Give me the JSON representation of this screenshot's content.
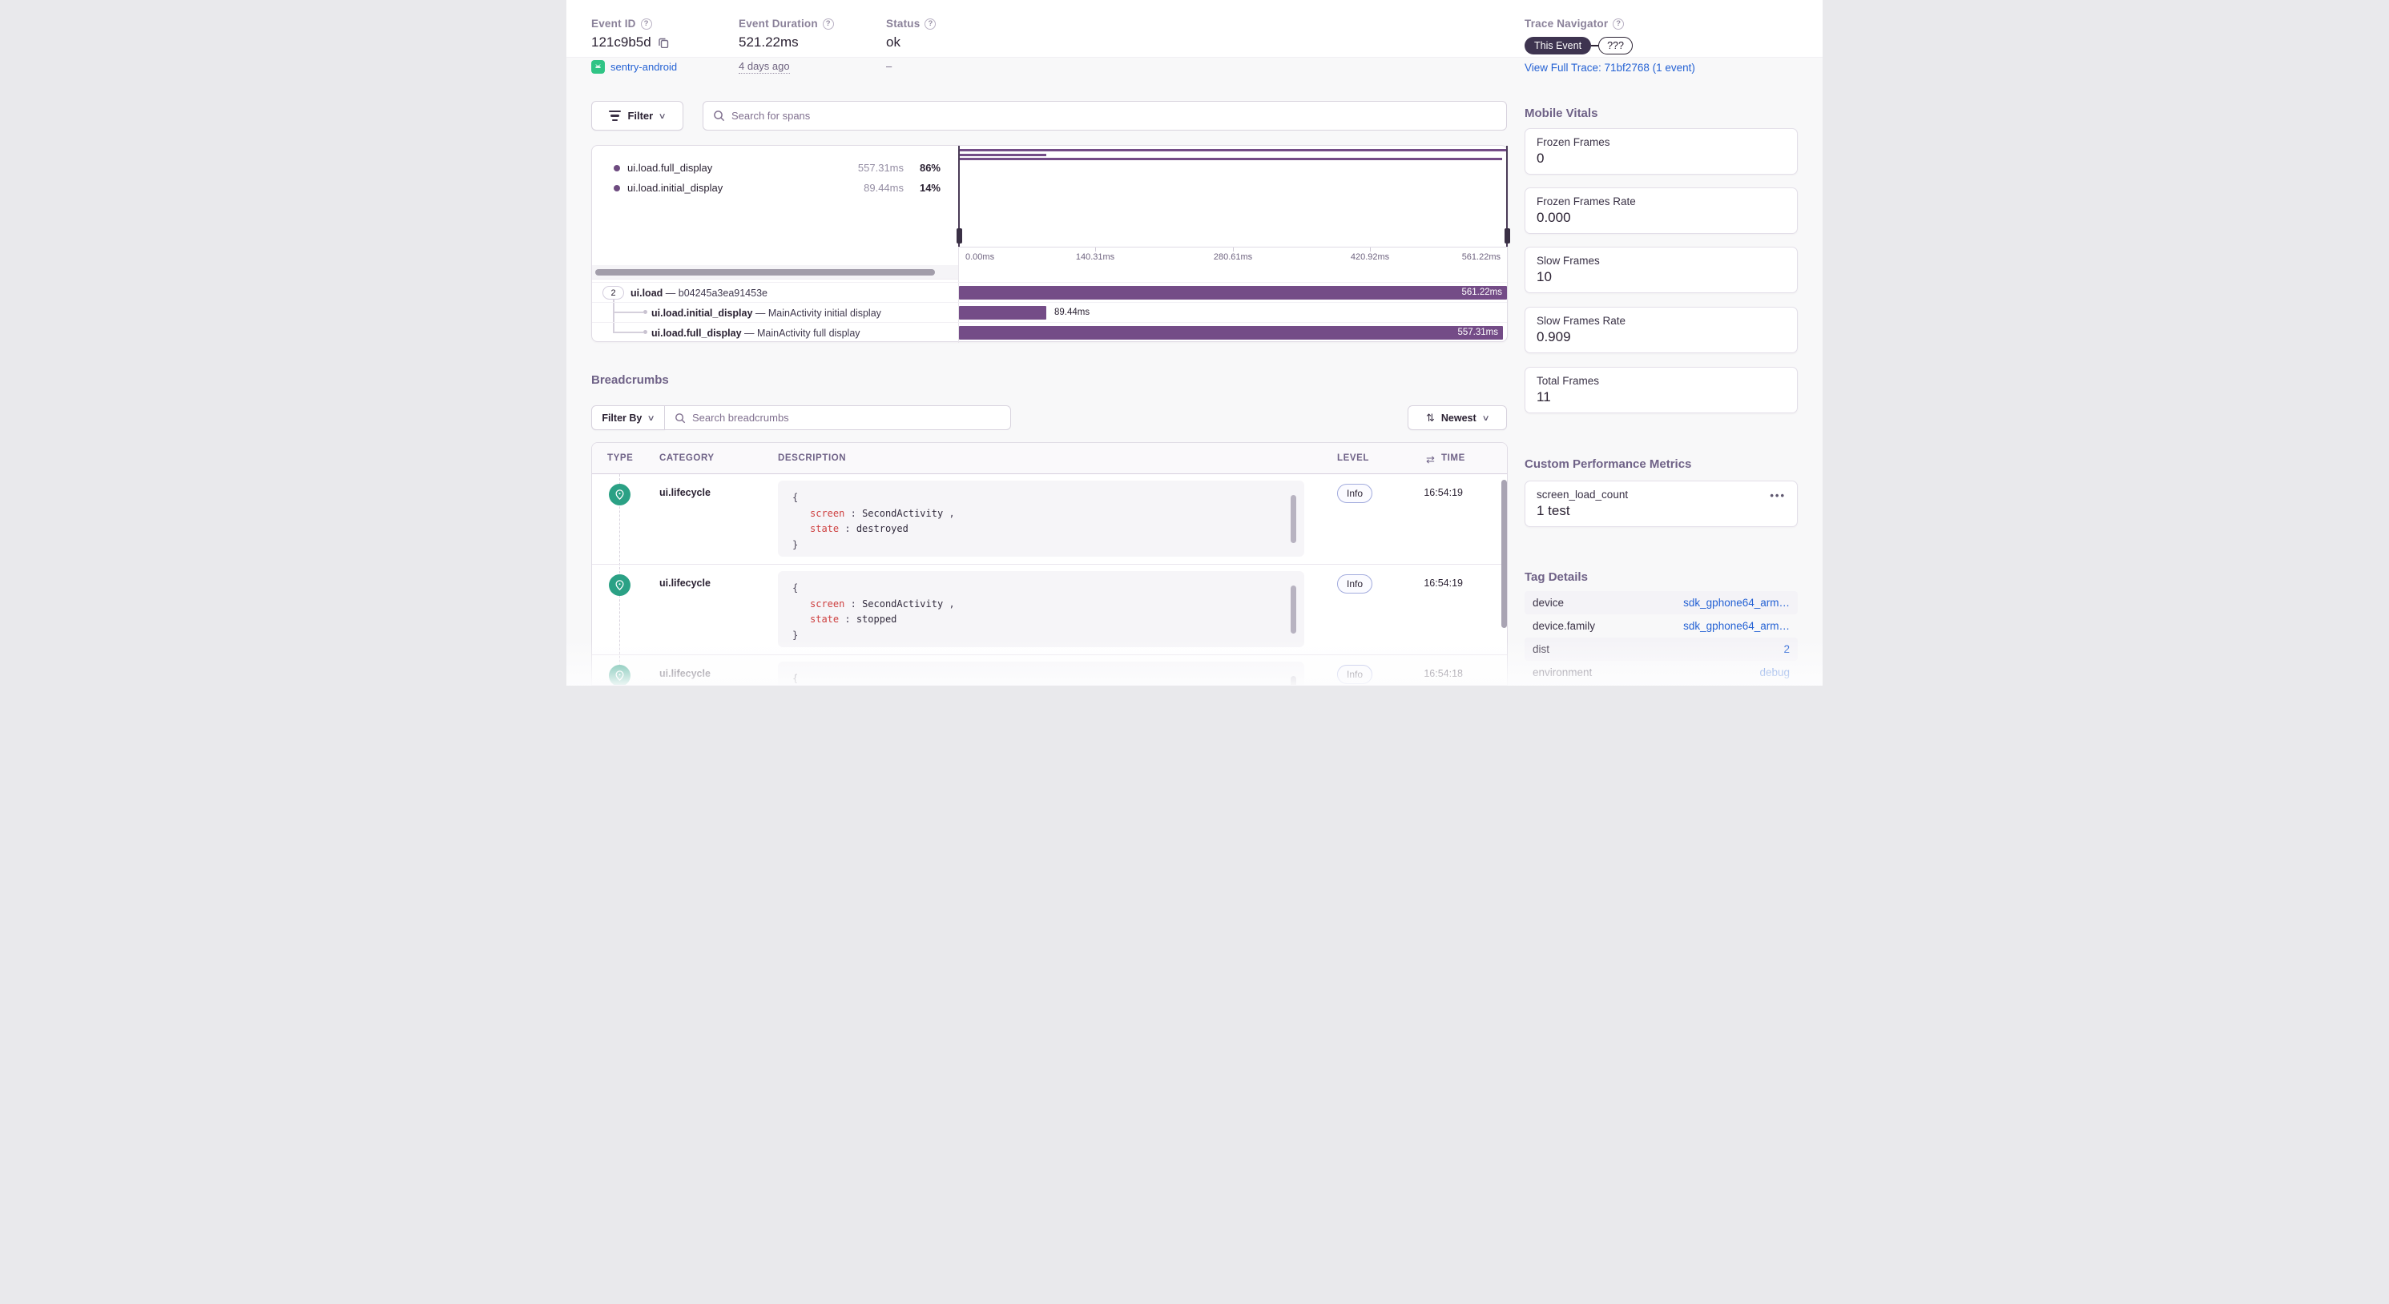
{
  "icons": {
    "help": "?",
    "chevron_down": "∨",
    "sort_updown": "⇅",
    "sort_leftright": "⇄",
    "ellipsis": "•••"
  },
  "header": {
    "event_id": {
      "label": "Event ID",
      "value": "121c9b5d",
      "project": "sentry-android"
    },
    "duration": {
      "label": "Event Duration",
      "value": "521.22ms",
      "age": "4 days ago"
    },
    "status": {
      "label": "Status",
      "value": "ok",
      "sub": "–"
    }
  },
  "trace_navigator": {
    "title": "Trace Navigator",
    "this_event": "This Event",
    "unknown": "???",
    "link": "View Full Trace: 71bf2768 (1 event)"
  },
  "spans": {
    "filter_label": "Filter",
    "search_placeholder": "Search for spans",
    "dash": "—",
    "legend": [
      {
        "name": "ui.load.full_display",
        "duration": "557.31ms",
        "percent": "86%"
      },
      {
        "name": "ui.load.initial_display",
        "duration": "89.44ms",
        "percent": "14%"
      }
    ],
    "minimap_bars": [
      {
        "width_pct": 100
      },
      {
        "width_pct": 15.9
      },
      {
        "width_pct": 99.3
      }
    ],
    "axis_ticks": [
      "0.00ms",
      "140.31ms",
      "280.61ms",
      "420.92ms",
      "561.22ms"
    ],
    "tree": [
      {
        "badge": "2",
        "op": "ui.load",
        "description": "b04245a3ea91453e",
        "duration": "561.22ms",
        "bar_width_pct": 100
      },
      {
        "op": "ui.load.initial_display",
        "description": "MainActivity initial display",
        "duration": "89.44ms",
        "bar_width_pct": 15.9
      },
      {
        "op": "ui.load.full_display",
        "description": "MainActivity full display",
        "duration": "557.31ms",
        "bar_width_pct": 99.3
      }
    ]
  },
  "breadcrumbs": {
    "title": "Breadcrumbs",
    "filter_label": "Filter By",
    "search_placeholder": "Search breadcrumbs",
    "sort_label": "Newest",
    "columns": [
      "TYPE",
      "CATEGORY",
      "DESCRIPTION",
      "LEVEL",
      "TIME"
    ],
    "punct": {
      "open": "{",
      "close": "}",
      "colon": ":",
      "comma": ","
    },
    "rows": [
      {
        "category": "ui.lifecycle",
        "level": "Info",
        "time": "16:54:19",
        "code": {
          "k1": "screen",
          "v1": "SecondActivity",
          "k2": "state",
          "v2": "destroyed"
        }
      },
      {
        "category": "ui.lifecycle",
        "level": "Info",
        "time": "16:54:19",
        "code": {
          "k1": "screen",
          "v1": "SecondActivity",
          "k2": "state",
          "v2": "stopped"
        }
      },
      {
        "category": "ui.lifecycle",
        "level": "Info",
        "time": "16:54:18",
        "code": {}
      }
    ]
  },
  "mobile_vitals": {
    "title": "Mobile Vitals",
    "cards": [
      {
        "label": "Frozen Frames",
        "value": "0"
      },
      {
        "label": "Frozen Frames Rate",
        "value": "0.000"
      },
      {
        "label": "Slow Frames",
        "value": "10"
      },
      {
        "label": "Slow Frames Rate",
        "value": "0.909"
      },
      {
        "label": "Total Frames",
        "value": "11"
      }
    ]
  },
  "custom_metrics": {
    "title": "Custom Performance Metrics",
    "cards": [
      {
        "label": "screen_load_count",
        "value": "1 test"
      }
    ]
  },
  "tag_details": {
    "title": "Tag Details",
    "rows": [
      {
        "key": "device",
        "value": "sdk_gphone64_arm…"
      },
      {
        "key": "device.family",
        "value": "sdk_gphone64_arm…"
      },
      {
        "key": "dist",
        "value": "2"
      },
      {
        "key": "environment",
        "value": "debug"
      }
    ]
  },
  "colors": {
    "accent_purple": "#744c87",
    "link_blue": "#2562d4",
    "android_green": "#30c485",
    "breadcrumb_teal": "#2ba185",
    "dark_pill": "#3e3450"
  }
}
